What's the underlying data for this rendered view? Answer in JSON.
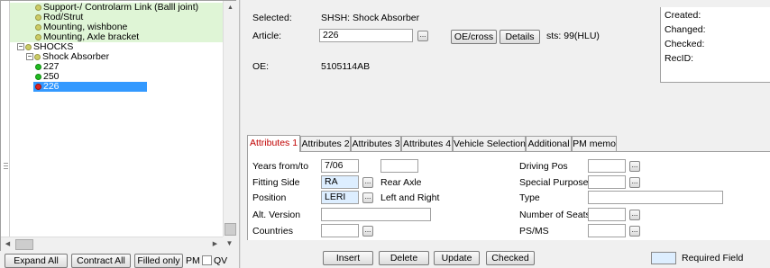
{
  "tree": {
    "items": [
      {
        "label": "Support-/ Controlarm Link (Balll joint)",
        "indent": 2,
        "dot": "y",
        "style": "green",
        "box": ""
      },
      {
        "label": "Rod/Strut",
        "indent": 2,
        "dot": "y",
        "style": "green",
        "box": ""
      },
      {
        "label": "Mounting, wishbone",
        "indent": 2,
        "dot": "y",
        "style": "green",
        "box": ""
      },
      {
        "label": "Mounting, Axle bracket",
        "indent": 2,
        "dot": "y",
        "style": "green",
        "box": ""
      },
      {
        "label": "SHOCKS",
        "indent": 0,
        "dot": "y",
        "style": "",
        "box": "−"
      },
      {
        "label": "Shock Absorber",
        "indent": 1,
        "dot": "y",
        "style": "",
        "box": "−"
      },
      {
        "label": "227",
        "indent": 2,
        "dot": "g",
        "style": "",
        "box": ""
      },
      {
        "label": "250",
        "indent": 2,
        "dot": "g",
        "style": "",
        "box": ""
      },
      {
        "label": "226",
        "indent": 2,
        "dot": "r",
        "style": "sel",
        "box": ""
      }
    ]
  },
  "left_buttons": {
    "expand_all": "Expand All",
    "contract_all": "Contract All",
    "filled_only": "Filled only",
    "pm": "PM",
    "qv": "QV"
  },
  "header": {
    "selected_label": "Selected:",
    "selected_value": "SHSH: Shock Absorber",
    "article_label": "Article:",
    "article_value": "226",
    "oe_cross_button": "OE/cross",
    "details_button": "Details",
    "status_text": "sts: 99(HLU)",
    "oe_label": "OE:",
    "oe_value": "5105114AB"
  },
  "meta": {
    "created": "Created:",
    "changed": "Changed:",
    "checked": "Checked:",
    "recid": "RecID:"
  },
  "tabs": [
    "Attributes 1",
    "Attributes 2",
    "Attributes 3",
    "Attributes 4",
    "Vehicle Selection",
    "Additional",
    "PM memo"
  ],
  "attributes": {
    "years_label": "Years from/to",
    "years_from": "7/06",
    "years_to": "",
    "fitting_side_label": "Fitting Side",
    "fitting_side_value": "RA",
    "fitting_side_desc": "Rear Axle",
    "position_label": "Position",
    "position_value": "LERI",
    "position_desc": "Left and Right",
    "alt_version_label": "Alt. Version",
    "alt_version_value": "",
    "countries_label": "Countries",
    "countries_value": "",
    "driving_pos_label": "Driving Pos",
    "special_purpose_label": "Special Purpose",
    "type_label": "Type",
    "number_of_seats_label": "Number of Seats",
    "psms_label": "PS/MS"
  },
  "actions": {
    "insert": "Insert",
    "delete": "Delete",
    "update": "Update",
    "checked": "Checked"
  },
  "legend": {
    "required_field": "Required Field",
    "required_color": "#ddeeff"
  },
  "colors": {
    "tree_highlight": "#dff5d6",
    "selection": "#3399ff",
    "active_tab_text": "#c00000"
  }
}
